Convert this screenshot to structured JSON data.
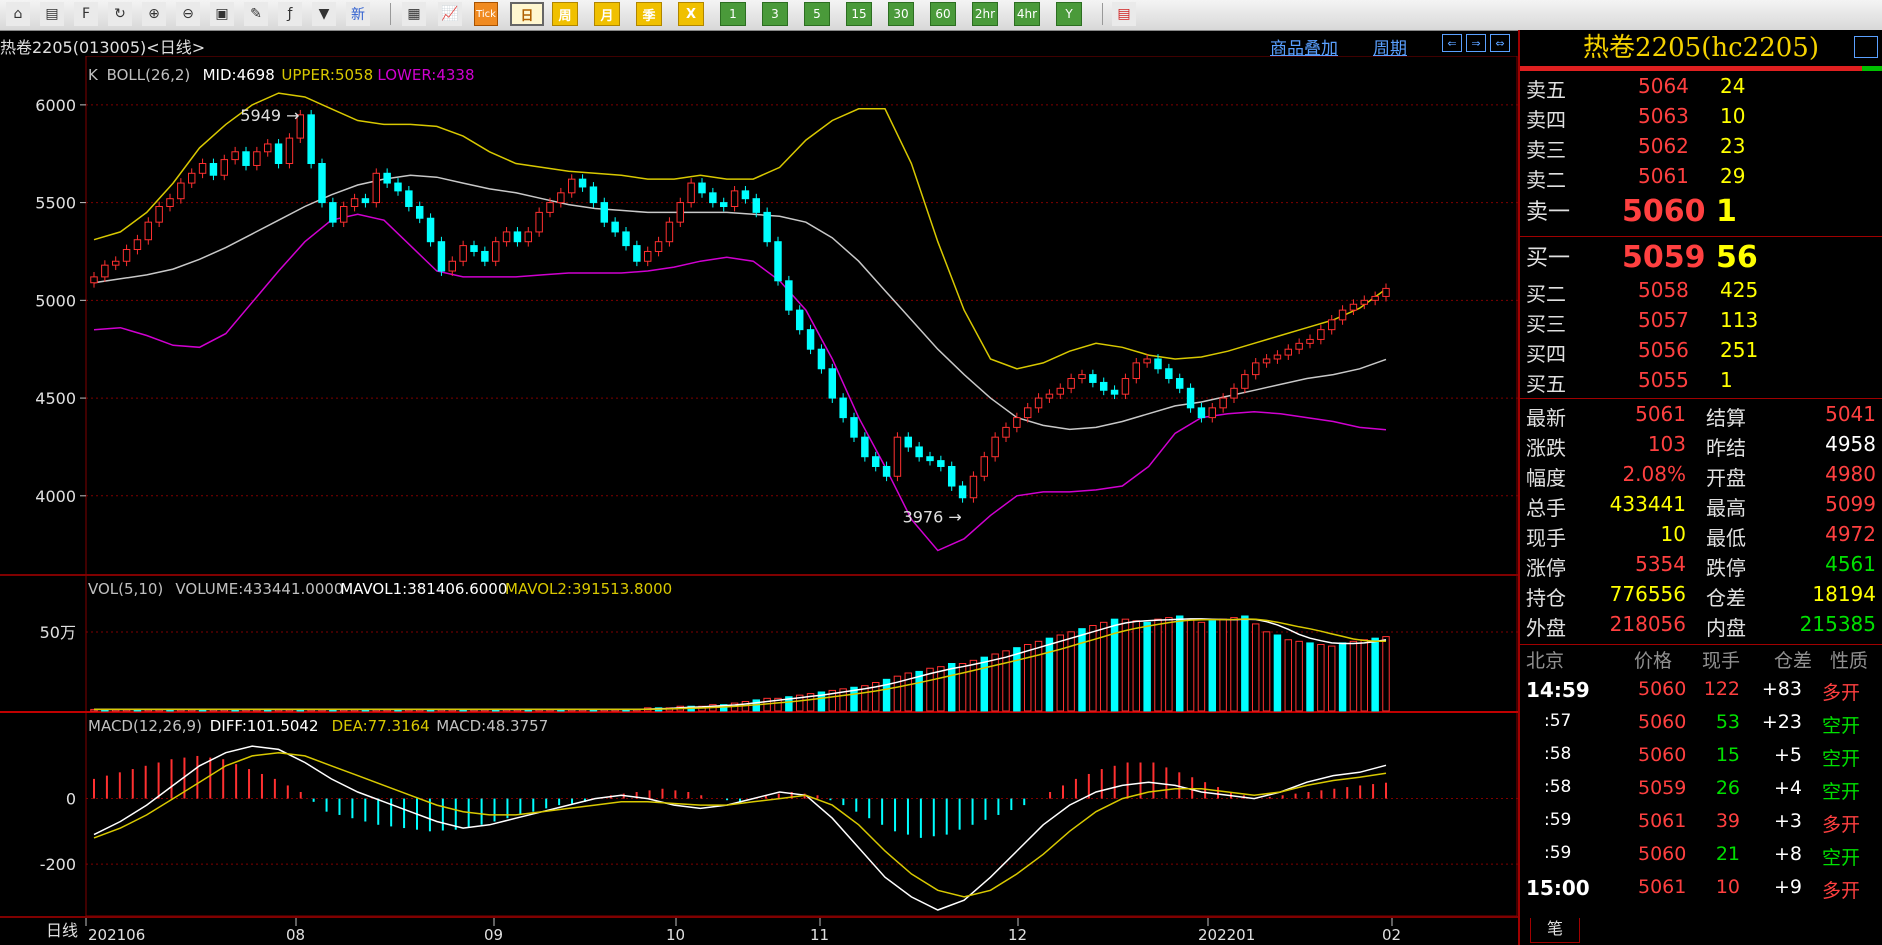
{
  "toolbar": {
    "period_buttons": [
      "日",
      "周",
      "月",
      "季",
      "X",
      "1",
      "3",
      "5",
      "15",
      "30",
      "60",
      "2hr",
      "4hr",
      "Y"
    ],
    "tick_label": "Tick",
    "new_label": "新"
  },
  "infobar": {
    "title": "热卷2205(013005)<日线>",
    "overlay_link": "商品叠加",
    "period_link": "周期"
  },
  "chart_data": {
    "type": "candlestick",
    "period_label": "日线",
    "x_labels": [
      "202106",
      "08",
      "09",
      "10",
      "11",
      "12",
      "202201",
      "02"
    ],
    "price_panel": {
      "legend": {
        "k": "K",
        "boll": "BOLL(26,2)",
        "mid": "MID:4698",
        "upper": "UPPER:5058",
        "lower": "LOWER:4338"
      },
      "y_ticks": [
        6000,
        5500,
        5000,
        4500,
        4000
      ],
      "ylim": [
        3600,
        6250
      ],
      "annotations": [
        {
          "text": "5949",
          "value": 5949
        },
        {
          "text": "3976",
          "value": 3976
        }
      ],
      "close": [
        5120,
        5180,
        5200,
        5260,
        5310,
        5400,
        5480,
        5520,
        5600,
        5650,
        5700,
        5640,
        5720,
        5760,
        5690,
        5760,
        5800,
        5700,
        5830,
        5949,
        5700,
        5500,
        5400,
        5480,
        5520,
        5500,
        5650,
        5600,
        5560,
        5480,
        5420,
        5300,
        5150,
        5200,
        5280,
        5250,
        5200,
        5300,
        5350,
        5300,
        5350,
        5450,
        5500,
        5550,
        5620,
        5580,
        5500,
        5400,
        5350,
        5280,
        5200,
        5250,
        5300,
        5400,
        5500,
        5600,
        5550,
        5500,
        5480,
        5560,
        5520,
        5450,
        5300,
        5100,
        4950,
        4850,
        4750,
        4650,
        4500,
        4400,
        4300,
        4200,
        4150,
        4100,
        4300,
        4250,
        4200,
        4180,
        4150,
        4050,
        3990,
        4100,
        4200,
        4300,
        4350,
        4400,
        4450,
        4500,
        4520,
        4550,
        4600,
        4620,
        4580,
        4540,
        4520,
        4600,
        4680,
        4700,
        4650,
        4600,
        4550,
        4450,
        4400,
        4450,
        4500,
        4550,
        4620,
        4680,
        4700,
        4720,
        4750,
        4780,
        4800,
        4850,
        4900,
        4950,
        4980,
        5000,
        5020,
        5061
      ],
      "mid": [
        5090,
        5110,
        5130,
        5160,
        5210,
        5270,
        5340,
        5410,
        5480,
        5540,
        5590,
        5620,
        5640,
        5630,
        5600,
        5570,
        5550,
        5520,
        5490,
        5470,
        5460,
        5450,
        5450,
        5450,
        5450,
        5440,
        5430,
        5400,
        5320,
        5200,
        5050,
        4900,
        4750,
        4620,
        4500,
        4400,
        4360,
        4340,
        4350,
        4380,
        4420,
        4460,
        4480,
        4510,
        4540,
        4570,
        4600,
        4620,
        4650,
        4698
      ],
      "upper": [
        5310,
        5350,
        5450,
        5600,
        5780,
        5900,
        6000,
        6060,
        6040,
        5980,
        5920,
        5900,
        5900,
        5890,
        5840,
        5760,
        5700,
        5680,
        5660,
        5650,
        5640,
        5620,
        5620,
        5640,
        5620,
        5620,
        5680,
        5820,
        5920,
        5980,
        5980,
        5700,
        5300,
        4950,
        4700,
        4650,
        4680,
        4740,
        4780,
        4760,
        4720,
        4700,
        4710,
        4740,
        4780,
        4820,
        4860,
        4900,
        4960,
        5058
      ],
      "lower": [
        4850,
        4860,
        4820,
        4770,
        4760,
        4830,
        4990,
        5150,
        5300,
        5410,
        5440,
        5410,
        5280,
        5150,
        5120,
        5120,
        5120,
        5130,
        5140,
        5140,
        5140,
        5150,
        5170,
        5200,
        5220,
        5200,
        5100,
        4950,
        4700,
        4400,
        4150,
        3880,
        3720,
        3780,
        3900,
        4000,
        4020,
        4020,
        4030,
        4050,
        4150,
        4320,
        4400,
        4420,
        4430,
        4420,
        4400,
        4380,
        4350,
        4338
      ]
    },
    "volume_panel": {
      "legend": {
        "vol": "VOL(5,10)",
        "volume": "VOLUME:433441.0000",
        "mavol1": "MAVOL1:381406.6000",
        "mavol2": "MAVOL2:391513.8000"
      },
      "y_tick_label": "50万",
      "volumes": [
        1,
        1,
        1,
        1,
        1,
        1,
        1,
        1,
        1,
        1,
        1,
        1,
        1,
        1,
        1,
        1,
        1,
        1,
        1,
        1,
        1,
        1,
        1,
        1,
        1,
        1,
        1,
        1,
        1,
        1,
        1,
        1,
        1,
        1,
        1,
        1,
        1,
        1,
        1,
        1,
        1,
        1,
        1,
        1,
        1,
        1,
        1,
        1,
        1,
        1,
        1,
        2,
        2,
        2,
        3,
        3,
        3,
        4,
        4,
        5,
        6,
        7,
        8,
        8,
        9,
        10,
        11,
        12,
        13,
        14,
        15,
        16,
        18,
        20,
        22,
        24,
        25,
        27,
        28,
        30,
        30,
        32,
        34,
        36,
        38,
        40,
        42,
        44,
        46,
        48,
        50,
        52,
        54,
        56,
        58,
        58,
        57,
        56,
        58,
        59,
        60,
        58,
        56,
        57,
        58,
        59,
        60,
        55,
        50,
        48,
        45,
        44,
        43,
        42,
        41,
        43,
        44,
        45,
        46,
        47
      ]
    },
    "macd_panel": {
      "legend": {
        "macd_params": "MACD(12,26,9)",
        "diff": "DIFF:101.5042",
        "dea": "DEA:77.3164",
        "macd": "MACD:48.3757"
      },
      "y_ticks": [
        0,
        -200
      ],
      "diff": [
        -110,
        -70,
        -20,
        40,
        100,
        140,
        160,
        150,
        110,
        60,
        20,
        -10,
        -40,
        -70,
        -90,
        -80,
        -60,
        -40,
        -20,
        0,
        10,
        0,
        -20,
        -30,
        -20,
        0,
        20,
        10,
        -60,
        -150,
        -240,
        -300,
        -340,
        -310,
        -240,
        -160,
        -80,
        -20,
        20,
        40,
        50,
        40,
        20,
        10,
        0,
        20,
        50,
        70,
        80,
        101.5
      ],
      "dea": [
        -120,
        -90,
        -50,
        0,
        50,
        100,
        130,
        140,
        130,
        100,
        70,
        40,
        10,
        -20,
        -40,
        -50,
        -50,
        -40,
        -30,
        -20,
        -10,
        -10,
        -15,
        -20,
        -20,
        -10,
        0,
        10,
        -20,
        -80,
        -160,
        -230,
        -280,
        -300,
        -280,
        -230,
        -170,
        -100,
        -40,
        0,
        20,
        30,
        30,
        20,
        10,
        20,
        40,
        55,
        65,
        77.3
      ],
      "hist": [
        60,
        80,
        100,
        120,
        130,
        120,
        90,
        60,
        20,
        -40,
        -60,
        -80,
        -90,
        -100,
        -95,
        -80,
        -60,
        -40,
        -20,
        -10,
        10,
        20,
        30,
        20,
        0,
        -10,
        10,
        20,
        10,
        -20,
        -60,
        -100,
        -120,
        -110,
        -80,
        -50,
        -20,
        20,
        60,
        90,
        110,
        110,
        80,
        50,
        20,
        0,
        10,
        20,
        30,
        40,
        48.4
      ]
    }
  },
  "panel": {
    "contract_title": "热卷2205(hc2205)",
    "asks": [
      {
        "label": "卖五",
        "price": "5064",
        "qty": "24"
      },
      {
        "label": "卖四",
        "price": "5063",
        "qty": "10"
      },
      {
        "label": "卖三",
        "price": "5062",
        "qty": "23"
      },
      {
        "label": "卖二",
        "price": "5061",
        "qty": "29"
      },
      {
        "label": "卖一",
        "price": "5060",
        "qty": "1"
      }
    ],
    "bids": [
      {
        "label": "买一",
        "price": "5059",
        "qty": "56"
      },
      {
        "label": "买二",
        "price": "5058",
        "qty": "425"
      },
      {
        "label": "买三",
        "price": "5057",
        "qty": "113"
      },
      {
        "label": "买四",
        "price": "5056",
        "qty": "251"
      },
      {
        "label": "买五",
        "price": "5055",
        "qty": "1"
      }
    ],
    "stats": [
      {
        "l1": "最新",
        "v1": "5061",
        "c1": "red",
        "l2": "结算",
        "v2": "5041",
        "c2": "red"
      },
      {
        "l1": "涨跌",
        "v1": "103",
        "c1": "red",
        "l2": "昨结",
        "v2": "4958",
        "c2": "wht"
      },
      {
        "l1": "幅度",
        "v1": "2.08%",
        "c1": "red",
        "l2": "开盘",
        "v2": "4980",
        "c2": "red"
      },
      {
        "l1": "总手",
        "v1": "433441",
        "c1": "yel",
        "l2": "最高",
        "v2": "5099",
        "c2": "red"
      },
      {
        "l1": "现手",
        "v1": "10",
        "c1": "yel",
        "l2": "最低",
        "v2": "4972",
        "c2": "red"
      },
      {
        "l1": "涨停",
        "v1": "5354",
        "c1": "red",
        "l2": "跌停",
        "v2": "4561",
        "c2": "grn2"
      },
      {
        "l1": "持仓",
        "v1": "776556",
        "c1": "yel",
        "l2": "仓差",
        "v2": "18194",
        "c2": "yel"
      },
      {
        "l1": "外盘",
        "v1": "218056",
        "c1": "red",
        "l2": "内盘",
        "v2": "215385",
        "c2": "grn2"
      }
    ],
    "trades_header": [
      "北京",
      "价格",
      "现手",
      "仓差",
      "性质"
    ],
    "trades": [
      {
        "time": "14:59",
        "price": "5060",
        "qty": "122",
        "oi": "+83",
        "type": "多开",
        "tc": "red",
        "bold": true
      },
      {
        "time": ":57",
        "price": "5060",
        "qty": "53",
        "oi": "+23",
        "type": "空开",
        "tc": "grn2",
        "bold": false
      },
      {
        "time": ":58",
        "price": "5060",
        "qty": "15",
        "oi": "+5",
        "type": "空开",
        "tc": "grn2",
        "bold": false
      },
      {
        "time": ":58",
        "price": "5059",
        "qty": "26",
        "oi": "+4",
        "type": "空开",
        "tc": "grn2",
        "bold": false
      },
      {
        "time": ":59",
        "price": "5061",
        "qty": "39",
        "oi": "+3",
        "type": "多开",
        "tc": "red",
        "bold": false
      },
      {
        "time": ":59",
        "price": "5060",
        "qty": "21",
        "oi": "+8",
        "type": "空开",
        "tc": "grn2",
        "bold": false
      },
      {
        "time": "15:00",
        "price": "5061",
        "qty": "10",
        "oi": "+9",
        "type": "多开",
        "tc": "red",
        "bold": true
      }
    ],
    "bottom_tab": "笔"
  },
  "colors": {
    "up": "#ff3030",
    "down": "#00ffff",
    "mid": "#c8c8c8",
    "upper": "#d8c800",
    "lower": "#d000d0",
    "grid": "#800000"
  }
}
